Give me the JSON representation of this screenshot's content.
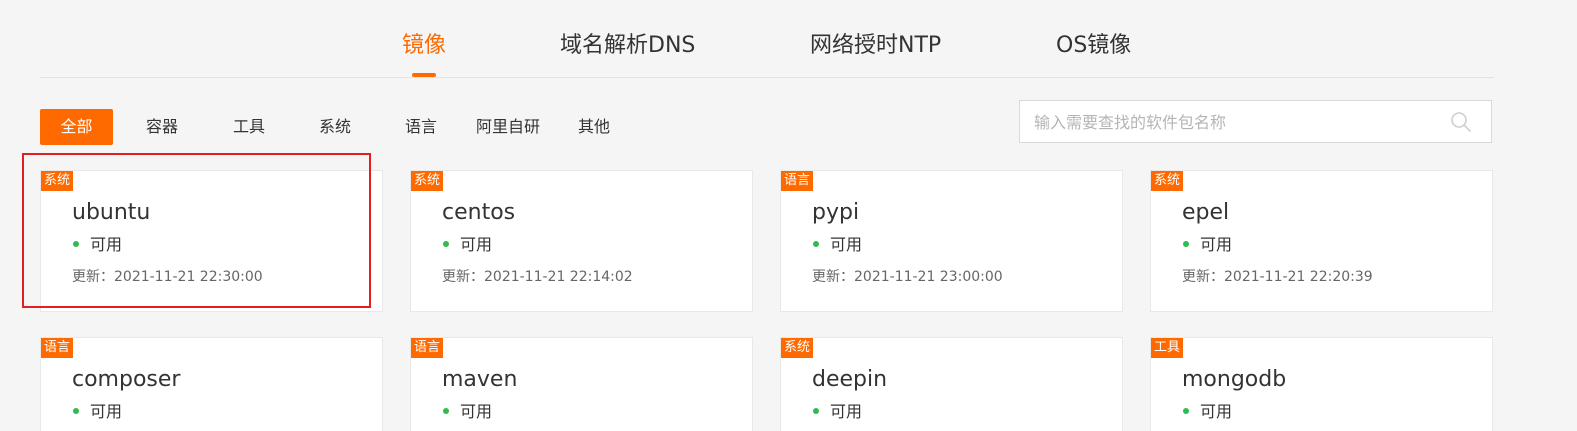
{
  "tabs": [
    {
      "label": "镜像",
      "active": true
    },
    {
      "label": "域名解析DNS",
      "active": false
    },
    {
      "label": "网络授时NTP",
      "active": false
    },
    {
      "label": "OS镜像",
      "active": false
    }
  ],
  "filters": [
    {
      "label": "全部",
      "active": true
    },
    {
      "label": "容器",
      "active": false
    },
    {
      "label": "工具",
      "active": false
    },
    {
      "label": "系统",
      "active": false
    },
    {
      "label": "语言",
      "active": false
    },
    {
      "label": "阿里自研",
      "active": false
    },
    {
      "label": "其他",
      "active": false
    }
  ],
  "search": {
    "placeholder": "输入需要查找的软件包名称",
    "value": "",
    "icon": "search-icon"
  },
  "cards": [
    {
      "badge": "系统",
      "name": "ubuntu",
      "status": "可用",
      "updated": "更新：2021-11-21 22:30:00",
      "highlighted": true
    },
    {
      "badge": "系统",
      "name": "centos",
      "status": "可用",
      "updated": "更新：2021-11-21 22:14:02"
    },
    {
      "badge": "语言",
      "name": "pypi",
      "status": "可用",
      "updated": "更新：2021-11-21 23:00:00"
    },
    {
      "badge": "系统",
      "name": "epel",
      "status": "可用",
      "updated": "更新：2021-11-21 22:20:39"
    },
    {
      "badge": "语言",
      "name": "composer",
      "status": "可用",
      "updated": ""
    },
    {
      "badge": "语言",
      "name": "maven",
      "status": "可用",
      "updated": ""
    },
    {
      "badge": "系统",
      "name": "deepin",
      "status": "可用",
      "updated": ""
    },
    {
      "badge": "工具",
      "name": "mongodb",
      "status": "可用",
      "updated": ""
    }
  ],
  "colors": {
    "accent": "#ff6a00",
    "status_ok": "#2fbb4f",
    "highlight": "#e02020"
  }
}
